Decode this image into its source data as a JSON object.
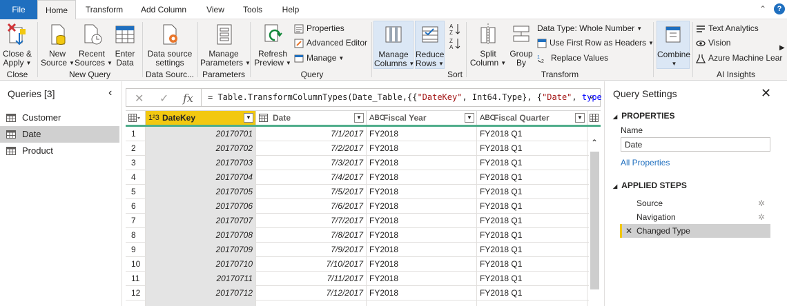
{
  "tabs": [
    "File",
    "Home",
    "Transform",
    "Add Column",
    "View",
    "Tools",
    "Help"
  ],
  "ribbon": {
    "close_apply": [
      "Close &",
      "Apply"
    ],
    "new_source": [
      "New",
      "Source"
    ],
    "recent_sources": [
      "Recent",
      "Sources"
    ],
    "enter_data": [
      "Enter",
      "Data"
    ],
    "data_source_settings": [
      "Data source",
      "settings"
    ],
    "manage_parameters": [
      "Manage",
      "Parameters"
    ],
    "refresh_preview": [
      "Refresh",
      "Preview"
    ],
    "properties": "Properties",
    "advanced_editor": "Advanced Editor",
    "manage": "Manage",
    "manage_columns": [
      "Manage",
      "Columns"
    ],
    "reduce_rows": [
      "Reduce",
      "Rows"
    ],
    "split_column": [
      "Split",
      "Column"
    ],
    "group_by": [
      "Group",
      "By"
    ],
    "data_type": "Data Type: Whole Number",
    "use_first_row": "Use First Row as Headers",
    "replace_values": "Replace Values",
    "combine": "Combine",
    "text_analytics": "Text Analytics",
    "vision": "Vision",
    "azure_ml": "Azure Machine Lear",
    "groups": {
      "close": "Close",
      "new_query": "New Query",
      "data_sources": "Data Sourc...",
      "parameters": "Parameters",
      "query": "Query",
      "sort": "Sort",
      "transform": "Transform",
      "ai_insights": "AI Insights"
    }
  },
  "queries_pane": {
    "title": "Queries [3]",
    "items": [
      {
        "label": "Customer",
        "selected": false
      },
      {
        "label": "Date",
        "selected": true
      },
      {
        "label": "Product",
        "selected": false
      }
    ]
  },
  "formula_bar": {
    "cancel": "✕",
    "confirm": "✓",
    "fx": "fx",
    "prefix": "= Table.TransformColumnTypes(Date_Table,{{",
    "s1": "\"DateKey\"",
    "mid": ", Int64.Type}, {",
    "s2": "\"Date\"",
    "sep": ", ",
    "kw": "type"
  },
  "grid": {
    "columns": [
      {
        "type": "1²3",
        "name": "DateKey"
      },
      {
        "type": "▦",
        "name": "Date"
      },
      {
        "type": "ABC",
        "name": "Fiscal Year"
      },
      {
        "type": "ABC",
        "name": "Fiscal Quarter"
      }
    ],
    "rows": [
      [
        "1",
        "20170701",
        "7/1/2017",
        "FY2018",
        "FY2018 Q1"
      ],
      [
        "2",
        "20170702",
        "7/2/2017",
        "FY2018",
        "FY2018 Q1"
      ],
      [
        "3",
        "20170703",
        "7/3/2017",
        "FY2018",
        "FY2018 Q1"
      ],
      [
        "4",
        "20170704",
        "7/4/2017",
        "FY2018",
        "FY2018 Q1"
      ],
      [
        "5",
        "20170705",
        "7/5/2017",
        "FY2018",
        "FY2018 Q1"
      ],
      [
        "6",
        "20170706",
        "7/6/2017",
        "FY2018",
        "FY2018 Q1"
      ],
      [
        "7",
        "20170707",
        "7/7/2017",
        "FY2018",
        "FY2018 Q1"
      ],
      [
        "8",
        "20170708",
        "7/8/2017",
        "FY2018",
        "FY2018 Q1"
      ],
      [
        "9",
        "20170709",
        "7/9/2017",
        "FY2018",
        "FY2018 Q1"
      ],
      [
        "10",
        "20170710",
        "7/10/2017",
        "FY2018",
        "FY2018 Q1"
      ],
      [
        "11",
        "20170711",
        "7/11/2017",
        "FY2018",
        "FY2018 Q1"
      ],
      [
        "12",
        "20170712",
        "7/12/2017",
        "FY2018",
        "FY2018 Q1"
      ]
    ]
  },
  "settings": {
    "title": "Query Settings",
    "properties_heading": "PROPERTIES",
    "name_label": "Name",
    "name_value": "Date",
    "all_properties": "All Properties",
    "steps_heading": "APPLIED STEPS",
    "steps": [
      {
        "label": "Source",
        "has_gear": true,
        "selected": false
      },
      {
        "label": "Navigation",
        "has_gear": true,
        "selected": false
      },
      {
        "label": "Changed Type",
        "has_gear": false,
        "selected": true
      }
    ]
  },
  "colors": {
    "file_tab": "#1f6fbf",
    "accent_yellow": "#f2c811",
    "header_underline": "#4fad8b",
    "ribbon_bg": "#f3f2f1",
    "selected_bg": "#d0d0d0"
  }
}
